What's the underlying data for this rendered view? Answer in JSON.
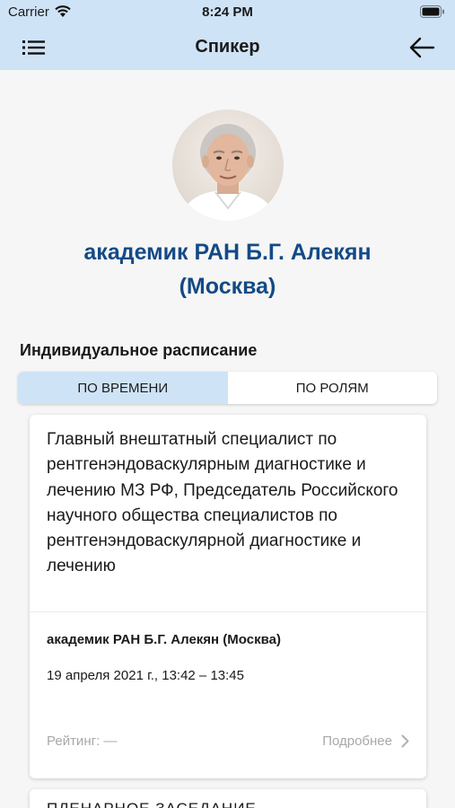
{
  "status_bar": {
    "carrier": "Carrier",
    "time": "8:24 PM"
  },
  "nav": {
    "title": "Спикер",
    "menu_icon": "list-icon",
    "back_icon": "arrow-left-icon"
  },
  "speaker": {
    "name": "академик РАН Б.Г. Алекян (Москва)"
  },
  "schedule": {
    "title": "Индивидуальное расписание",
    "tabs": [
      {
        "label": "ПО ВРЕМЕНИ",
        "active": true
      },
      {
        "label": "ПО РОЛЯМ",
        "active": false
      }
    ]
  },
  "sessions": [
    {
      "description": "Главный внештатный специалист по рентгенэндоваскулярным диагностике и лечению МЗ РФ, Председатель Российского научного общества специалистов по рентгенэндоваскулярной диагностике и лечению",
      "speaker": "академик РАН Б.Г. Алекян (Москва)",
      "time": "19 апреля 2021 г., 13:42 – 13:45",
      "rating": "Рейтинг: —",
      "more": "Подробнее"
    },
    {
      "title": "ПЛЕНАРНОЕ ЗАСЕДАНИЕ"
    }
  ],
  "colors": {
    "accent_bg": "#cfe3f6",
    "name": "#134a85",
    "muted": "#a8a8a8"
  }
}
